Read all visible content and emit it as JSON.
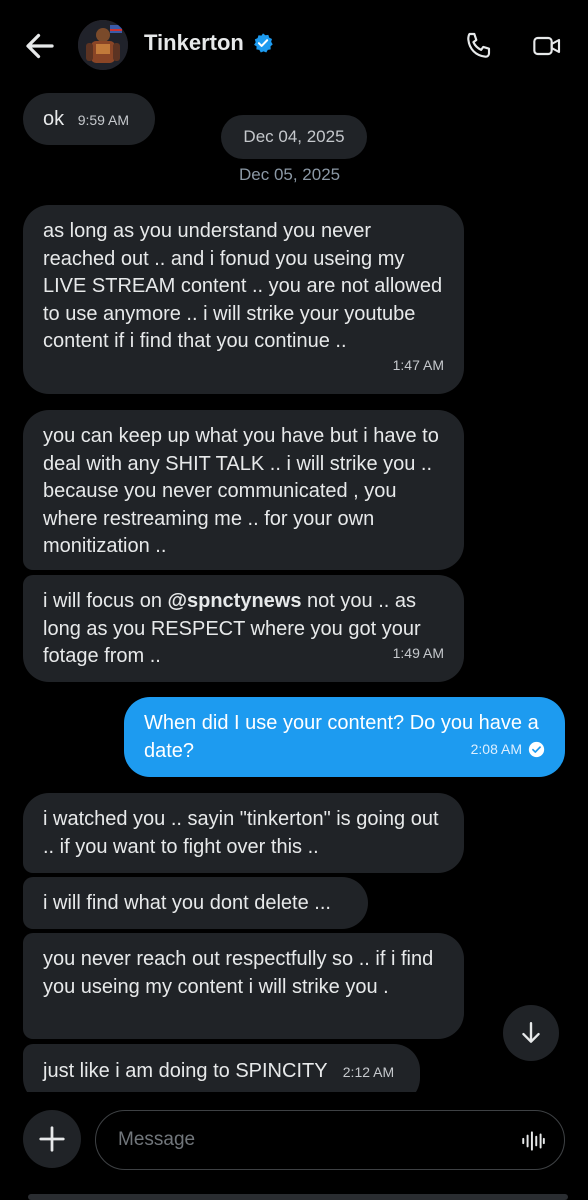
{
  "header": {
    "title": "Tinkerton",
    "icons": {
      "back": "back-arrow-icon",
      "verified": "verified-badge-icon",
      "call": "phone-icon",
      "video": "video-camera-icon"
    }
  },
  "dates": {
    "pill": "Dec 04, 2025",
    "label": "Dec 05, 2025"
  },
  "messages": [
    {
      "from": "them",
      "text": "ok",
      "time": "9:59 AM"
    },
    {
      "from": "them",
      "text": "as long as you understand you never reached out .. and i fonud you useing my LIVE STREAM content .. you are not allowed to use anymore .. i will strike your youtube content if i find that you continue ..",
      "time": "1:47 AM"
    },
    {
      "from": "them",
      "text": "you can keep up what you have but i have to deal with any SHIT TALK .. i will strike you .. because you never communicated , you where restreaming me .. for your own monitization .."
    },
    {
      "from": "them",
      "text_pre": "i will focus on ",
      "mention": "@spnctynews",
      "text_post": "  not you .. as long as you RESPECT where you got your fotage from ..",
      "time": "1:49 AM"
    },
    {
      "from": "me",
      "text": "When did I use your content? Do you have a date?",
      "time": "2:08 AM",
      "status": "read-check-icon"
    },
    {
      "from": "them",
      "text": "i watched you .. sayin \"tinkerton\" is going out .. if you want to fight over this .."
    },
    {
      "from": "them",
      "text": "i will find what you dont delete ..."
    },
    {
      "from": "them",
      "text": "you never reach out respectfully so .. if i find you useing my content i will strike you ."
    },
    {
      "from": "them",
      "text": "just like i am doing to SPINCITY",
      "time": "2:12 AM"
    }
  ],
  "composer": {
    "placeholder": "Message",
    "icons": {
      "add": "plus-icon",
      "voice": "voice-wave-icon",
      "scroll": "arrow-down-icon"
    }
  },
  "colors": {
    "accent": "#1d9bf0",
    "bubble": "#202327",
    "background": "#000000"
  }
}
